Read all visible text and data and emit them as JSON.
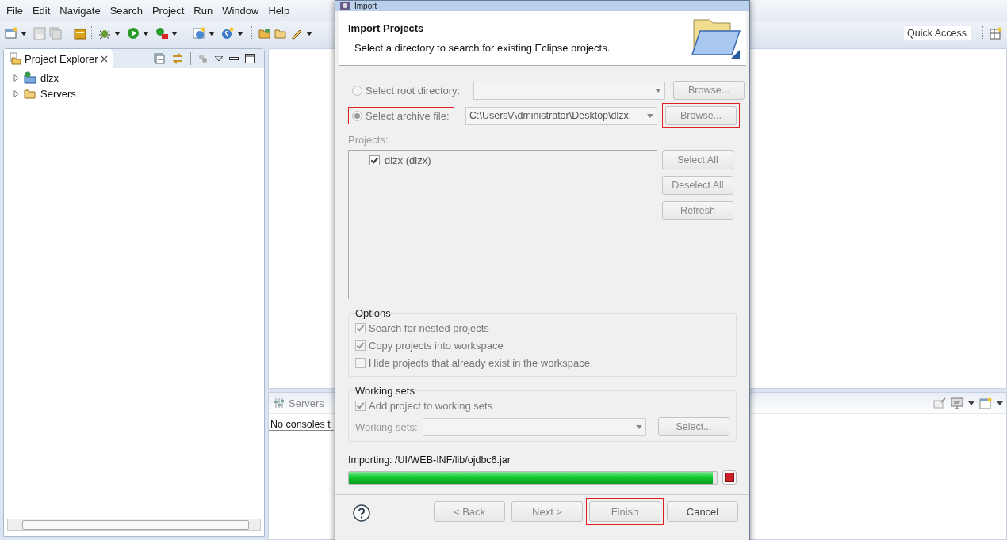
{
  "menu": [
    "File",
    "Edit",
    "Navigate",
    "Search",
    "Project",
    "Run",
    "Window",
    "Help"
  ],
  "quick_access": {
    "placeholder": "Quick Access"
  },
  "project_explorer": {
    "title": "Project Explorer",
    "items": [
      {
        "label": "dlzx",
        "expanded": false
      },
      {
        "label": "Servers",
        "expanded": false
      }
    ]
  },
  "console": {
    "tab": "Servers",
    "message": "No consoles t"
  },
  "dialog": {
    "title": "Import",
    "header": {
      "title": "Import Projects",
      "description": "Select a directory to search for existing Eclipse projects."
    },
    "sources": [
      {
        "label": "Select root directory:",
        "selected": false,
        "highlighted": false,
        "browse": {
          "label": "Browse...",
          "highlighted": false
        }
      },
      {
        "label": "Select archive file:",
        "selected": true,
        "highlighted": true,
        "path": "C:\\Users\\Administrator\\Desktop\\dlzx.",
        "browse": {
          "label": "Browse...",
          "highlighted": true
        }
      }
    ],
    "projects": {
      "label": "Projects:",
      "items": [
        {
          "label": "dlzx (dlzx)",
          "checked": true
        }
      ],
      "buttons": [
        "Select All",
        "Deselect All",
        "Refresh"
      ]
    },
    "options": {
      "title": "Options",
      "items": [
        {
          "label": "Search for nested projects",
          "checked": true
        },
        {
          "label": "Copy projects into workspace",
          "checked": true
        },
        {
          "label": "Hide projects that already exist in the workspace",
          "checked": false
        }
      ]
    },
    "working_sets": {
      "title": "Working sets",
      "add": {
        "label": "Add project to working sets",
        "checked": true
      },
      "label": "Working sets:",
      "button": "Select..."
    },
    "progress": {
      "label": "Importing: /UI/WEB-INF/lib/ojdbc6.jar",
      "level": 0.99
    },
    "buttons": [
      {
        "label": "< Back",
        "highlighted": false
      },
      {
        "label": "Next >",
        "highlighted": false
      },
      {
        "label": "Finish",
        "highlighted": true
      },
      {
        "label": "Cancel",
        "highlighted": false
      }
    ]
  }
}
